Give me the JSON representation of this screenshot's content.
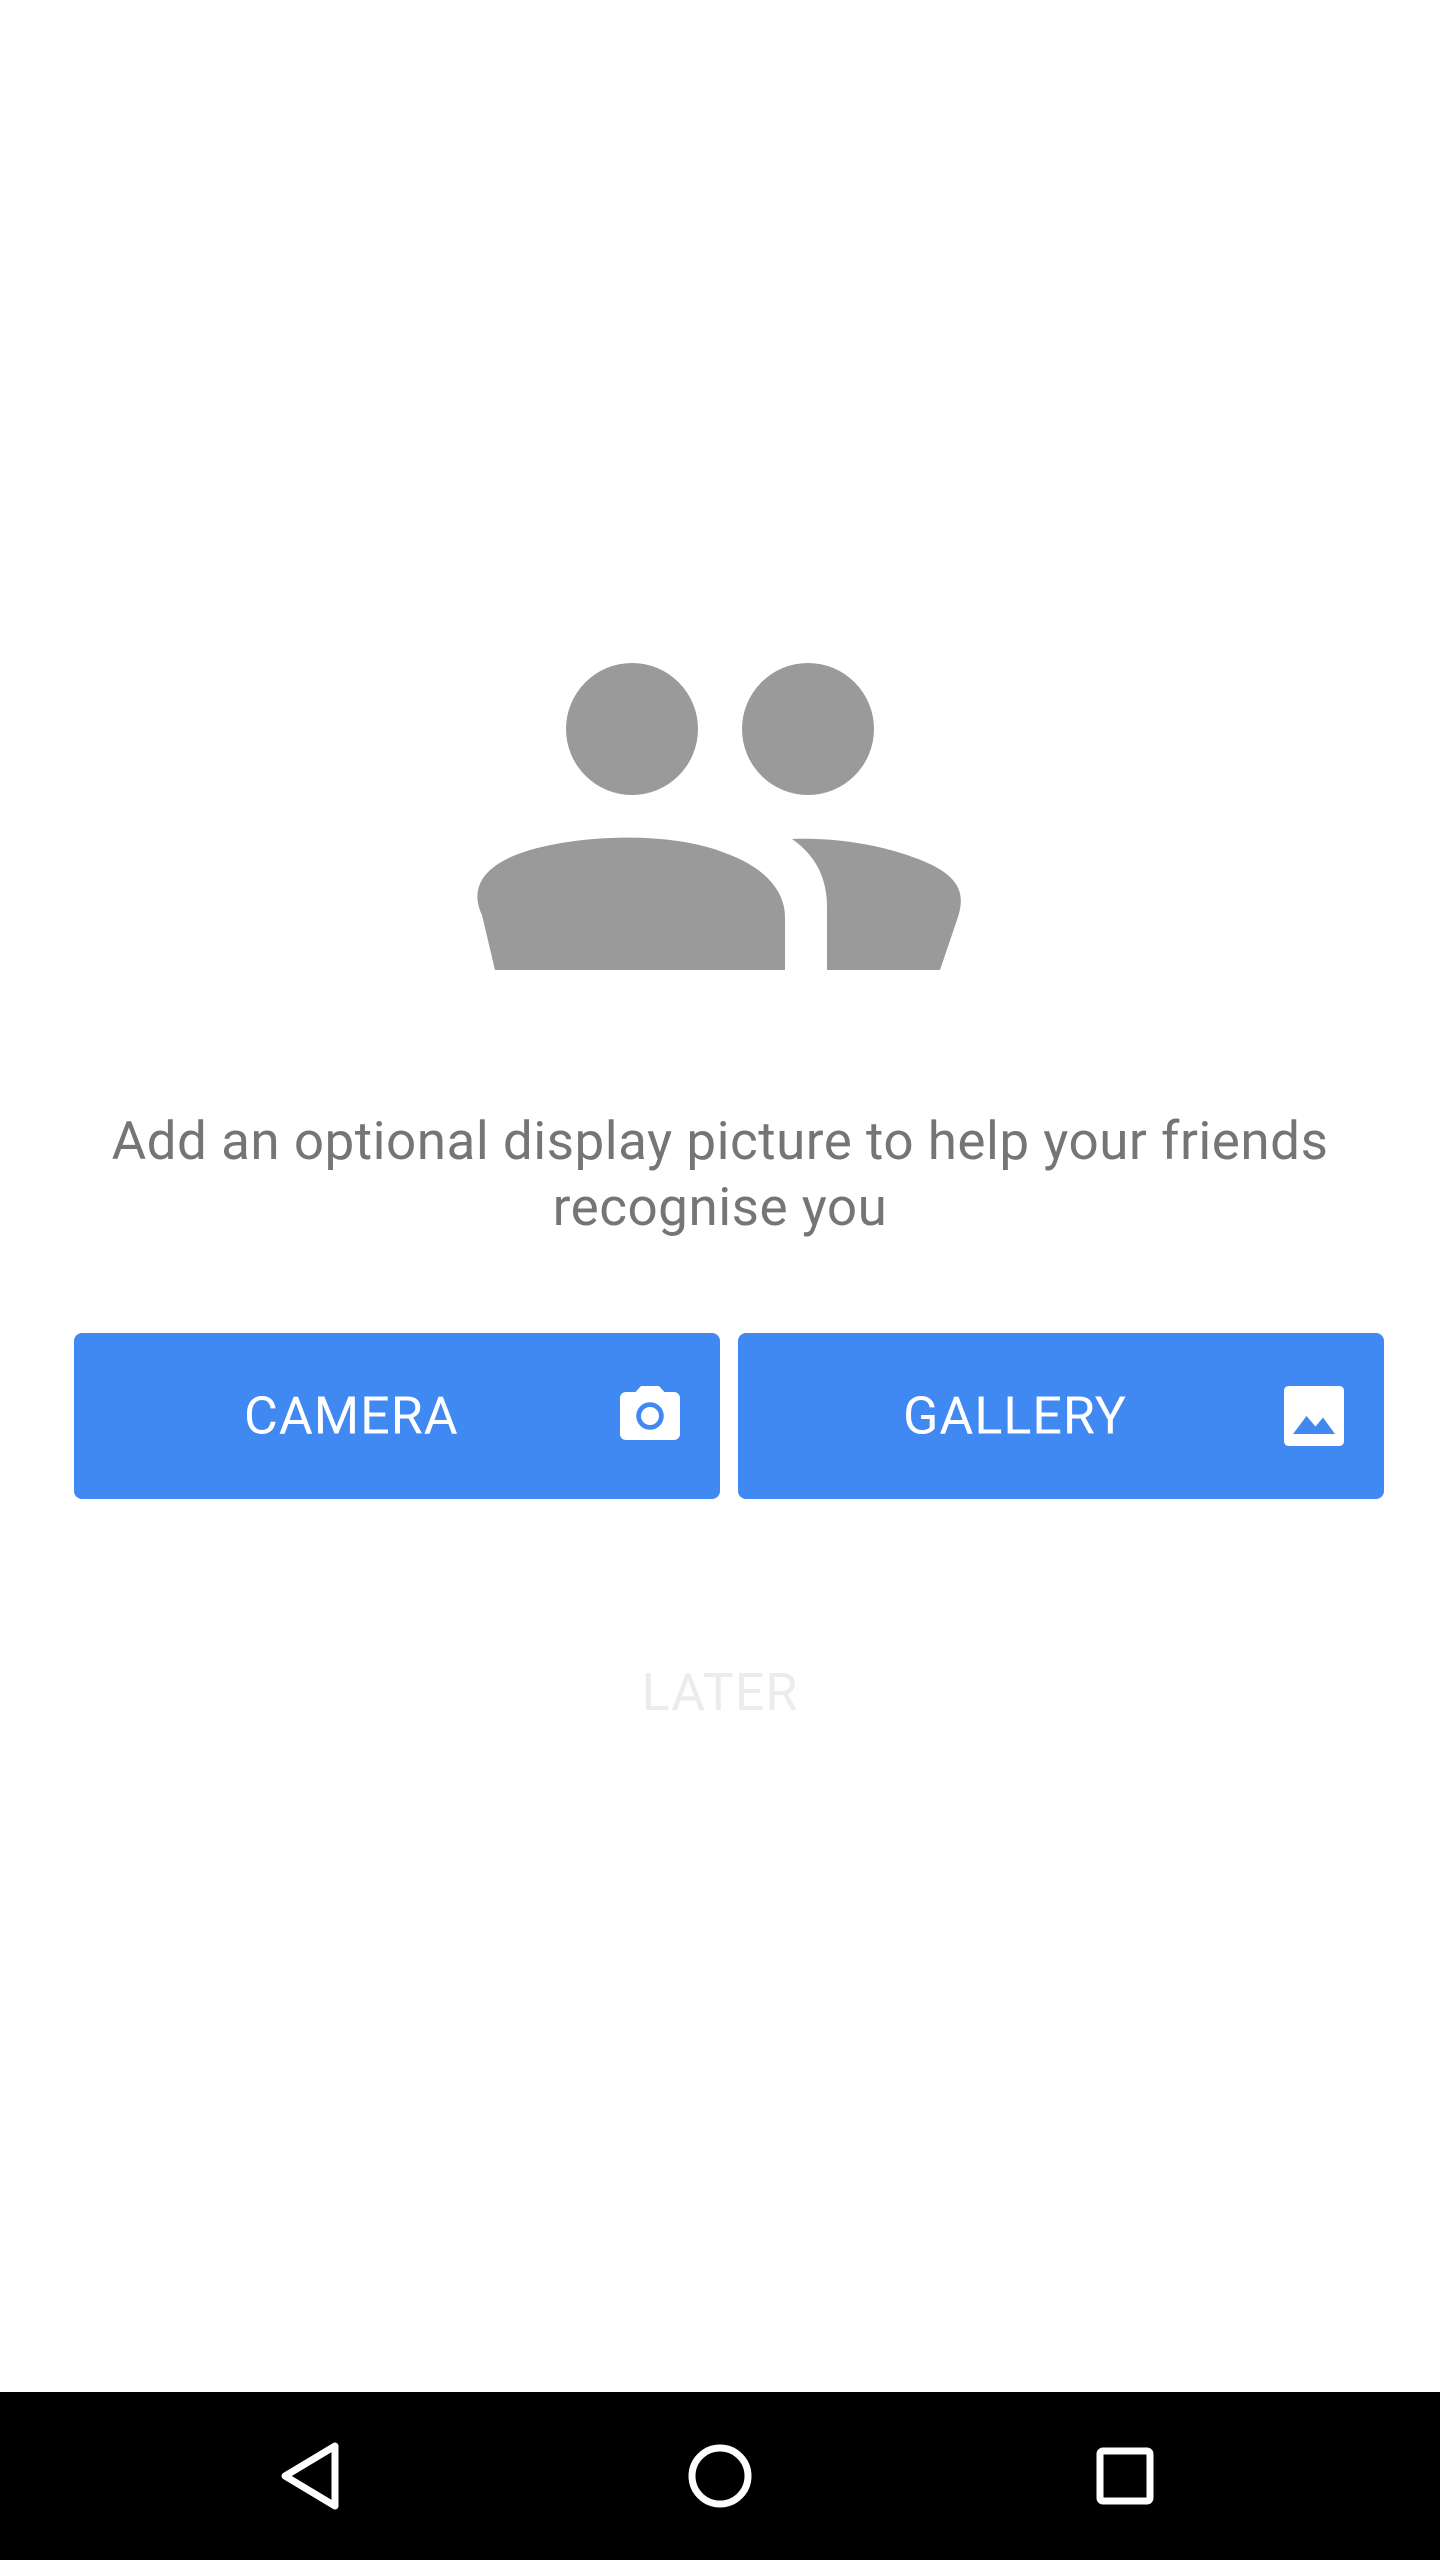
{
  "prompt": {
    "text": "Add an optional display picture to help your friends recognise you"
  },
  "buttons": {
    "camera": {
      "label": "CAMERA",
      "icon": "camera-icon"
    },
    "gallery": {
      "label": "GALLERY",
      "icon": "image-icon"
    },
    "later": {
      "label": "LATER"
    }
  },
  "illustration": {
    "icon": "people-icon",
    "color": "#9a9a9a"
  },
  "colors": {
    "accent": "#4189f2",
    "prompt_text": "#757575",
    "later_text": "#ececec",
    "navbar": "#000000"
  },
  "navbar": {
    "back": "back-icon",
    "home": "home-icon",
    "recents": "recents-icon"
  }
}
